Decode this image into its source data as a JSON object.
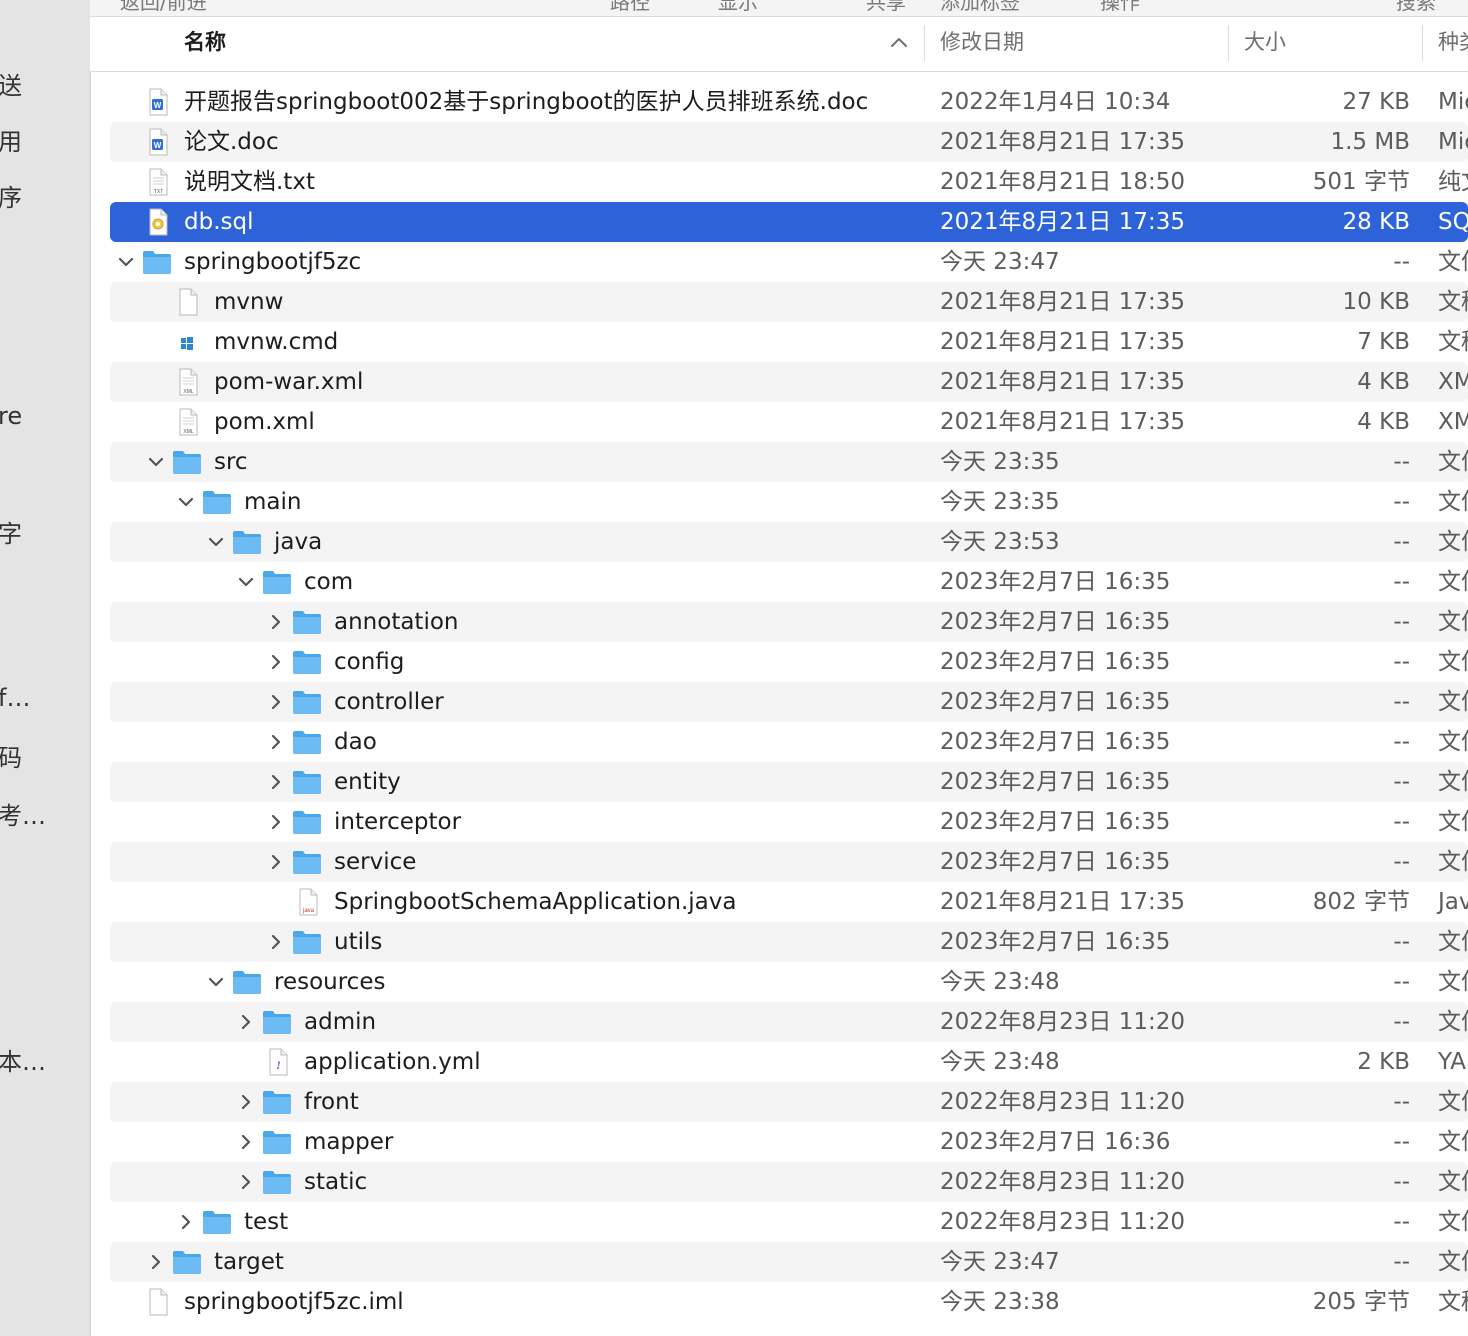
{
  "sidebar": {
    "items": [
      "送",
      "用",
      "序",
      "re",
      "字",
      "f…",
      "码",
      "考…",
      "本…"
    ]
  },
  "toolbar": {
    "labels": [
      "返回/前进",
      "路径",
      "显示",
      "共享",
      "添加标签",
      "操作",
      "搜索"
    ]
  },
  "header": {
    "name": "名称",
    "date": "修改日期",
    "size": "大小",
    "kind": "种类"
  },
  "files": [
    {
      "name": "开题报告springboot002基于springboot的医护人员排班系统.doc",
      "date": "2022年1月4日 10:34",
      "size": "27 KB",
      "kind": "Microsoft Word 文稿",
      "level": 0,
      "type": "file",
      "icon": "word-doc-icon"
    },
    {
      "name": "论文.doc",
      "date": "2021年8月21日 17:35",
      "size": "1.5 MB",
      "kind": "Microsoft Word 文稿",
      "level": 0,
      "type": "file",
      "icon": "word-doc-icon"
    },
    {
      "name": "说明文档.txt",
      "date": "2021年8月21日 18:50",
      "size": "501 字节",
      "kind": "纯文本文稿",
      "level": 0,
      "type": "file",
      "icon": "txt-file-icon"
    },
    {
      "name": "db.sql",
      "date": "2021年8月21日 17:35",
      "size": "28 KB",
      "kind": "SQL",
      "level": 0,
      "type": "file",
      "icon": "sql-file-icon",
      "selected": true
    },
    {
      "name": "springbootjf5zc",
      "date": "今天 23:47",
      "size": "--",
      "kind": "文件夹",
      "level": 0,
      "type": "folder",
      "expanded": true,
      "icon": "folder-icon"
    },
    {
      "name": "mvnw",
      "date": "2021年8月21日 17:35",
      "size": "10 KB",
      "kind": "文稿",
      "level": 1,
      "type": "file",
      "icon": "blank-file-icon"
    },
    {
      "name": "mvnw.cmd",
      "date": "2021年8月21日 17:35",
      "size": "7 KB",
      "kind": "文稿",
      "level": 1,
      "type": "file",
      "icon": "windows-cmd-icon"
    },
    {
      "name": "pom-war.xml",
      "date": "2021年8月21日 17:35",
      "size": "4 KB",
      "kind": "XML",
      "level": 1,
      "type": "file",
      "icon": "xml-file-icon"
    },
    {
      "name": "pom.xml",
      "date": "2021年8月21日 17:35",
      "size": "4 KB",
      "kind": "XML",
      "level": 1,
      "type": "file",
      "icon": "xml-file-icon"
    },
    {
      "name": "src",
      "date": "今天 23:35",
      "size": "--",
      "kind": "文件夹",
      "level": 1,
      "type": "folder",
      "expanded": true,
      "icon": "folder-icon"
    },
    {
      "name": "main",
      "date": "今天 23:35",
      "size": "--",
      "kind": "文件夹",
      "level": 2,
      "type": "folder",
      "expanded": true,
      "icon": "folder-icon"
    },
    {
      "name": "java",
      "date": "今天 23:53",
      "size": "--",
      "kind": "文件夹",
      "level": 3,
      "type": "folder",
      "expanded": true,
      "icon": "folder-icon"
    },
    {
      "name": "com",
      "date": "2023年2月7日 16:35",
      "size": "--",
      "kind": "文件夹",
      "level": 4,
      "type": "folder",
      "expanded": true,
      "icon": "folder-icon"
    },
    {
      "name": "annotation",
      "date": "2023年2月7日 16:35",
      "size": "--",
      "kind": "文件夹",
      "level": 5,
      "type": "folder",
      "expanded": false,
      "icon": "folder-icon"
    },
    {
      "name": "config",
      "date": "2023年2月7日 16:35",
      "size": "--",
      "kind": "文件夹",
      "level": 5,
      "type": "folder",
      "expanded": false,
      "icon": "folder-icon"
    },
    {
      "name": "controller",
      "date": "2023年2月7日 16:35",
      "size": "--",
      "kind": "文件夹",
      "level": 5,
      "type": "folder",
      "expanded": false,
      "icon": "folder-icon"
    },
    {
      "name": "dao",
      "date": "2023年2月7日 16:35",
      "size": "--",
      "kind": "文件夹",
      "level": 5,
      "type": "folder",
      "expanded": false,
      "icon": "folder-icon"
    },
    {
      "name": "entity",
      "date": "2023年2月7日 16:35",
      "size": "--",
      "kind": "文件夹",
      "level": 5,
      "type": "folder",
      "expanded": false,
      "icon": "folder-icon"
    },
    {
      "name": "interceptor",
      "date": "2023年2月7日 16:35",
      "size": "--",
      "kind": "文件夹",
      "level": 5,
      "type": "folder",
      "expanded": false,
      "icon": "folder-icon"
    },
    {
      "name": "service",
      "date": "2023年2月7日 16:35",
      "size": "--",
      "kind": "文件夹",
      "level": 5,
      "type": "folder",
      "expanded": false,
      "icon": "folder-icon"
    },
    {
      "name": "SpringbootSchemaApplication.java",
      "date": "2021年8月21日 17:35",
      "size": "802 字节",
      "kind": "Java",
      "level": 5,
      "type": "file",
      "icon": "java-file-icon"
    },
    {
      "name": "utils",
      "date": "2023年2月7日 16:35",
      "size": "--",
      "kind": "文件夹",
      "level": 5,
      "type": "folder",
      "expanded": false,
      "icon": "folder-icon"
    },
    {
      "name": "resources",
      "date": "今天 23:48",
      "size": "--",
      "kind": "文件夹",
      "level": 3,
      "type": "folder",
      "expanded": true,
      "icon": "folder-icon"
    },
    {
      "name": "admin",
      "date": "2022年8月23日 11:20",
      "size": "--",
      "kind": "文件夹",
      "level": 4,
      "type": "folder",
      "expanded": false,
      "icon": "folder-icon"
    },
    {
      "name": "application.yml",
      "date": "今天 23:48",
      "size": "2 KB",
      "kind": "YAML",
      "level": 4,
      "type": "file",
      "icon": "yaml-file-icon"
    },
    {
      "name": "front",
      "date": "2022年8月23日 11:20",
      "size": "--",
      "kind": "文件夹",
      "level": 4,
      "type": "folder",
      "expanded": false,
      "icon": "folder-icon"
    },
    {
      "name": "mapper",
      "date": "2023年2月7日 16:36",
      "size": "--",
      "kind": "文件夹",
      "level": 4,
      "type": "folder",
      "expanded": false,
      "icon": "folder-icon"
    },
    {
      "name": "static",
      "date": "2022年8月23日 11:20",
      "size": "--",
      "kind": "文件夹",
      "level": 4,
      "type": "folder",
      "expanded": false,
      "icon": "folder-icon"
    },
    {
      "name": "test",
      "date": "2022年8月23日 11:20",
      "size": "--",
      "kind": "文件夹",
      "level": 2,
      "type": "folder",
      "expanded": false,
      "icon": "folder-icon"
    },
    {
      "name": "target",
      "date": "今天 23:47",
      "size": "--",
      "kind": "文件夹",
      "level": 1,
      "type": "folder",
      "expanded": false,
      "icon": "folder-icon"
    },
    {
      "name": "springbootjf5zc.iml",
      "date": "今天 23:38",
      "size": "205 字节",
      "kind": "文稿",
      "level": 0,
      "type": "file",
      "icon": "blank-file-icon"
    }
  ],
  "colors": {
    "selection": "#2d62d9",
    "folder": "#5fb4f0",
    "stripe": "#f4f4f5"
  }
}
